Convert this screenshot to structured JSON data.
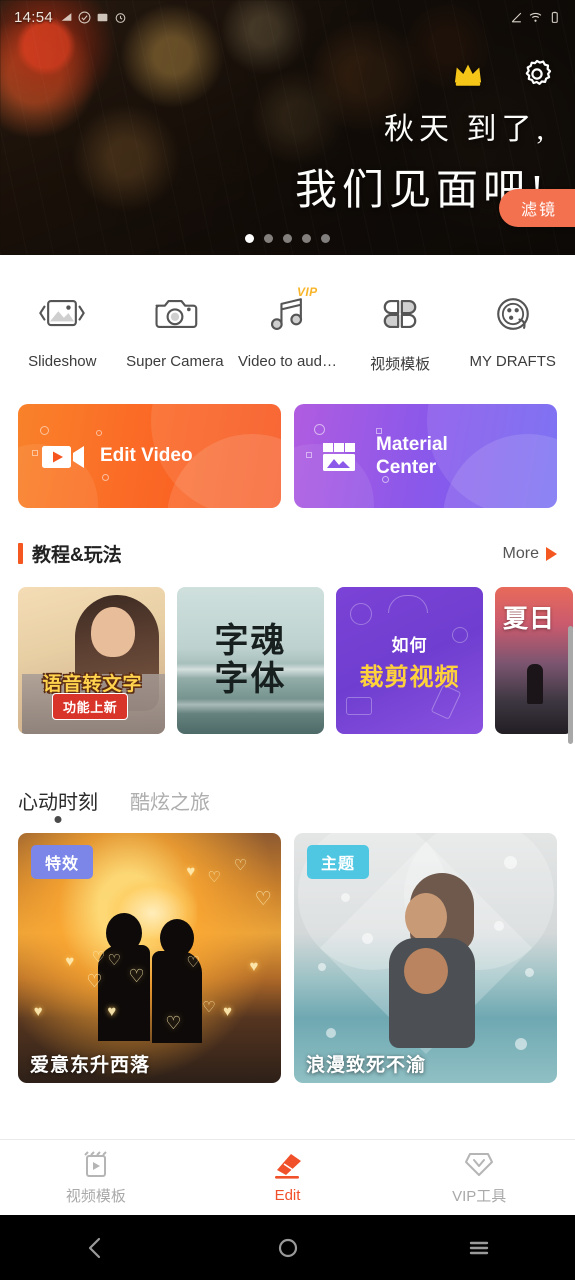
{
  "statusbar": {
    "time": "14:54",
    "left_icons": [
      "signal-icon",
      "check-icon",
      "message-icon",
      "alarm-icon"
    ],
    "right_icons": [
      "network-icon",
      "wifi-icon",
      "battery-icon"
    ]
  },
  "hero": {
    "crown_icon": "crown-icon",
    "gear_icon": "gear-icon",
    "line1": "秋天 到了,",
    "line2": "我们见面吧!",
    "badge": "滤镜",
    "dot_count": 5,
    "active_dot": 0
  },
  "tools": [
    {
      "label": "Slideshow",
      "icon": "image-slideshow-icon",
      "vip": ""
    },
    {
      "label": "Super Camera",
      "icon": "camera-icon",
      "vip": ""
    },
    {
      "label": "Video to aud…",
      "icon": "music-note-icon",
      "vip": "VIP"
    },
    {
      "label": "视频模板",
      "icon": "grid-template-icon",
      "vip": ""
    },
    {
      "label": "MY DRAFTS",
      "icon": "film-reel-icon",
      "vip": ""
    }
  ],
  "bigcards": [
    {
      "label": "Edit Video",
      "icon": "video-camera-icon",
      "accent": "#f7551f"
    },
    {
      "label": "Material\nCenter",
      "icon": "store-image-icon",
      "accent": "#6e63f2"
    }
  ],
  "bigcards_text": {
    "edit": "Edit Video",
    "material_l1": "Material",
    "material_l2": "Center"
  },
  "tutorial_section": {
    "title": "教程&玩法",
    "more_label": "More",
    "more_icon": "triangle-right-icon",
    "items": [
      {
        "title": "语音转文字",
        "subtitle": "功能上新"
      },
      {
        "line1": "字魂",
        "line2": "字体"
      },
      {
        "line1": "如何",
        "line2": "裁剪视频"
      },
      {
        "title": "夏日"
      }
    ]
  },
  "tabs": [
    {
      "label": "心动时刻",
      "active": true
    },
    {
      "label": "酷炫之旅",
      "active": false
    }
  ],
  "content_cards": [
    {
      "badge": "特效",
      "badge_color": "#7b86e8",
      "title": "爱意东升西落"
    },
    {
      "badge": "主题",
      "badge_color": "#4fc7e3",
      "title": "浪漫致死不渝"
    }
  ],
  "bottom_nav": [
    {
      "label": "视频模板",
      "icon": "film-template-icon",
      "active": false
    },
    {
      "label": "Edit",
      "icon": "eraser-edit-icon",
      "active": true
    },
    {
      "label": "VIP工具",
      "icon": "diamond-vip-icon",
      "active": false
    }
  ],
  "system_nav": [
    {
      "icon": "back-chevron-icon"
    },
    {
      "icon": "home-circle-icon"
    },
    {
      "icon": "recents-menu-icon"
    }
  ],
  "colors": {
    "accent_orange": "#f0502a",
    "vip_yellow": "#f9b52a",
    "banner_badge": "#f3714f",
    "section_bar": "#f4571f"
  }
}
